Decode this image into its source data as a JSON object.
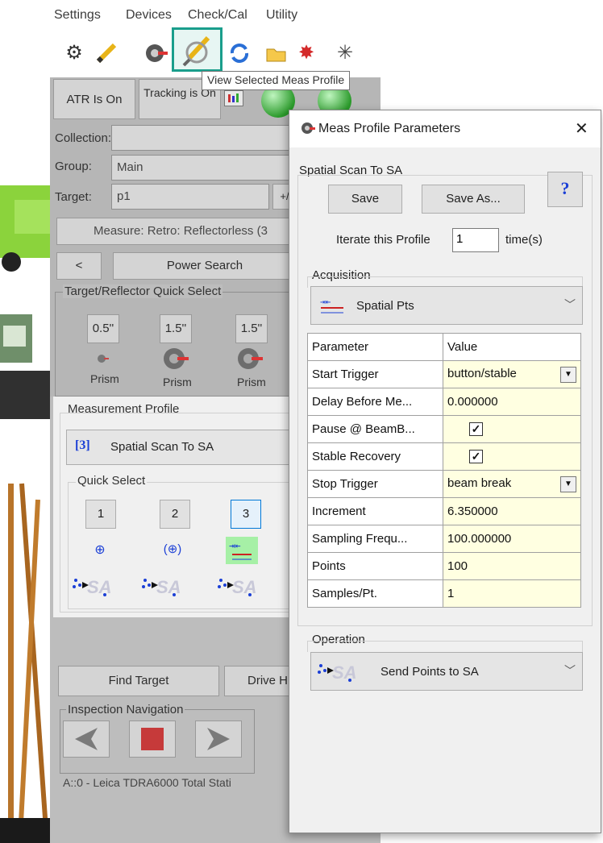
{
  "menu": [
    "Settings",
    "Devices",
    "Check/Cal",
    "Utility"
  ],
  "tooltip": "View Selected Meas Profile",
  "toolbar_icons": [
    "gear-icon",
    "pencil-icon",
    "target-icon",
    "magnifier-icon",
    "refresh-icon",
    "folder-icon",
    "sparkle-red-icon",
    "sparkle-icon"
  ],
  "panel": {
    "atr_button": "ATR Is On",
    "tracking_button": "Tracking is On",
    "collection_label": "Collection:",
    "group_label": "Group:",
    "group_value": "Main",
    "target_label": "Target:",
    "target_value": "p1",
    "target_plus": "+/",
    "measure_mode": "Measure: Retro: Reflectorless (3",
    "prev_button": "<",
    "power_search": "Power Search",
    "quick_select_title": "Target/Reflector Quick Select",
    "reflectors": [
      {
        "size": "0.5''",
        "label": "Prism"
      },
      {
        "size": "1.5''",
        "label": "Prism"
      },
      {
        "size": "1.5''",
        "label": "Prism"
      }
    ],
    "measurement_profile_title": "Measurement Profile",
    "profile_index": "[3]",
    "profile_name": "Spatial Scan To SA",
    "profile_quick_select_title": "Quick Select",
    "quick_buttons": [
      "1",
      "2",
      "3"
    ],
    "find_target": "Find Target",
    "drive_button": "Drive H",
    "inspection_nav_title": "Inspection Navigation",
    "status_line": "A::0 - Leica TDRA6000 Total Stati"
  },
  "dialog": {
    "title": "Meas Profile Parameters",
    "close": "✕",
    "group_title": "Spatial Scan To SA",
    "save": "Save",
    "save_as": "Save As...",
    "help": "?",
    "iterate_label": "Iterate this Profile",
    "iterate_value": "1",
    "iterate_unit": "time(s)",
    "acquisition_title": "Acquisition",
    "acquisition_value": "Spatial Pts",
    "table_headers": [
      "Parameter",
      "Value"
    ],
    "params": [
      {
        "name": "Start Trigger",
        "value": "button/stable",
        "type": "dropdown"
      },
      {
        "name": "Delay Before Me...",
        "value": "0.000000",
        "type": "text"
      },
      {
        "name": "Pause @ BeamB...",
        "value": true,
        "type": "checkbox"
      },
      {
        "name": "Stable Recovery",
        "value": true,
        "type": "checkbox"
      },
      {
        "name": "Stop Trigger",
        "value": "beam break",
        "type": "dropdown"
      },
      {
        "name": "Increment",
        "value": "6.350000",
        "type": "text"
      },
      {
        "name": "Sampling Frequ...",
        "value": "100.000000",
        "type": "text"
      },
      {
        "name": "Points",
        "value": "100",
        "type": "text"
      },
      {
        "name": "Samples/Pt.",
        "value": "1",
        "type": "text"
      }
    ],
    "operation_title": "Operation",
    "operation_value": "Send Points to SA"
  },
  "colors": {
    "highlight": "#1a9e8c",
    "blue_index": "#1b3fd6",
    "panel_bg": "#bdbdbd",
    "cell_bg": "#ffffe1"
  }
}
